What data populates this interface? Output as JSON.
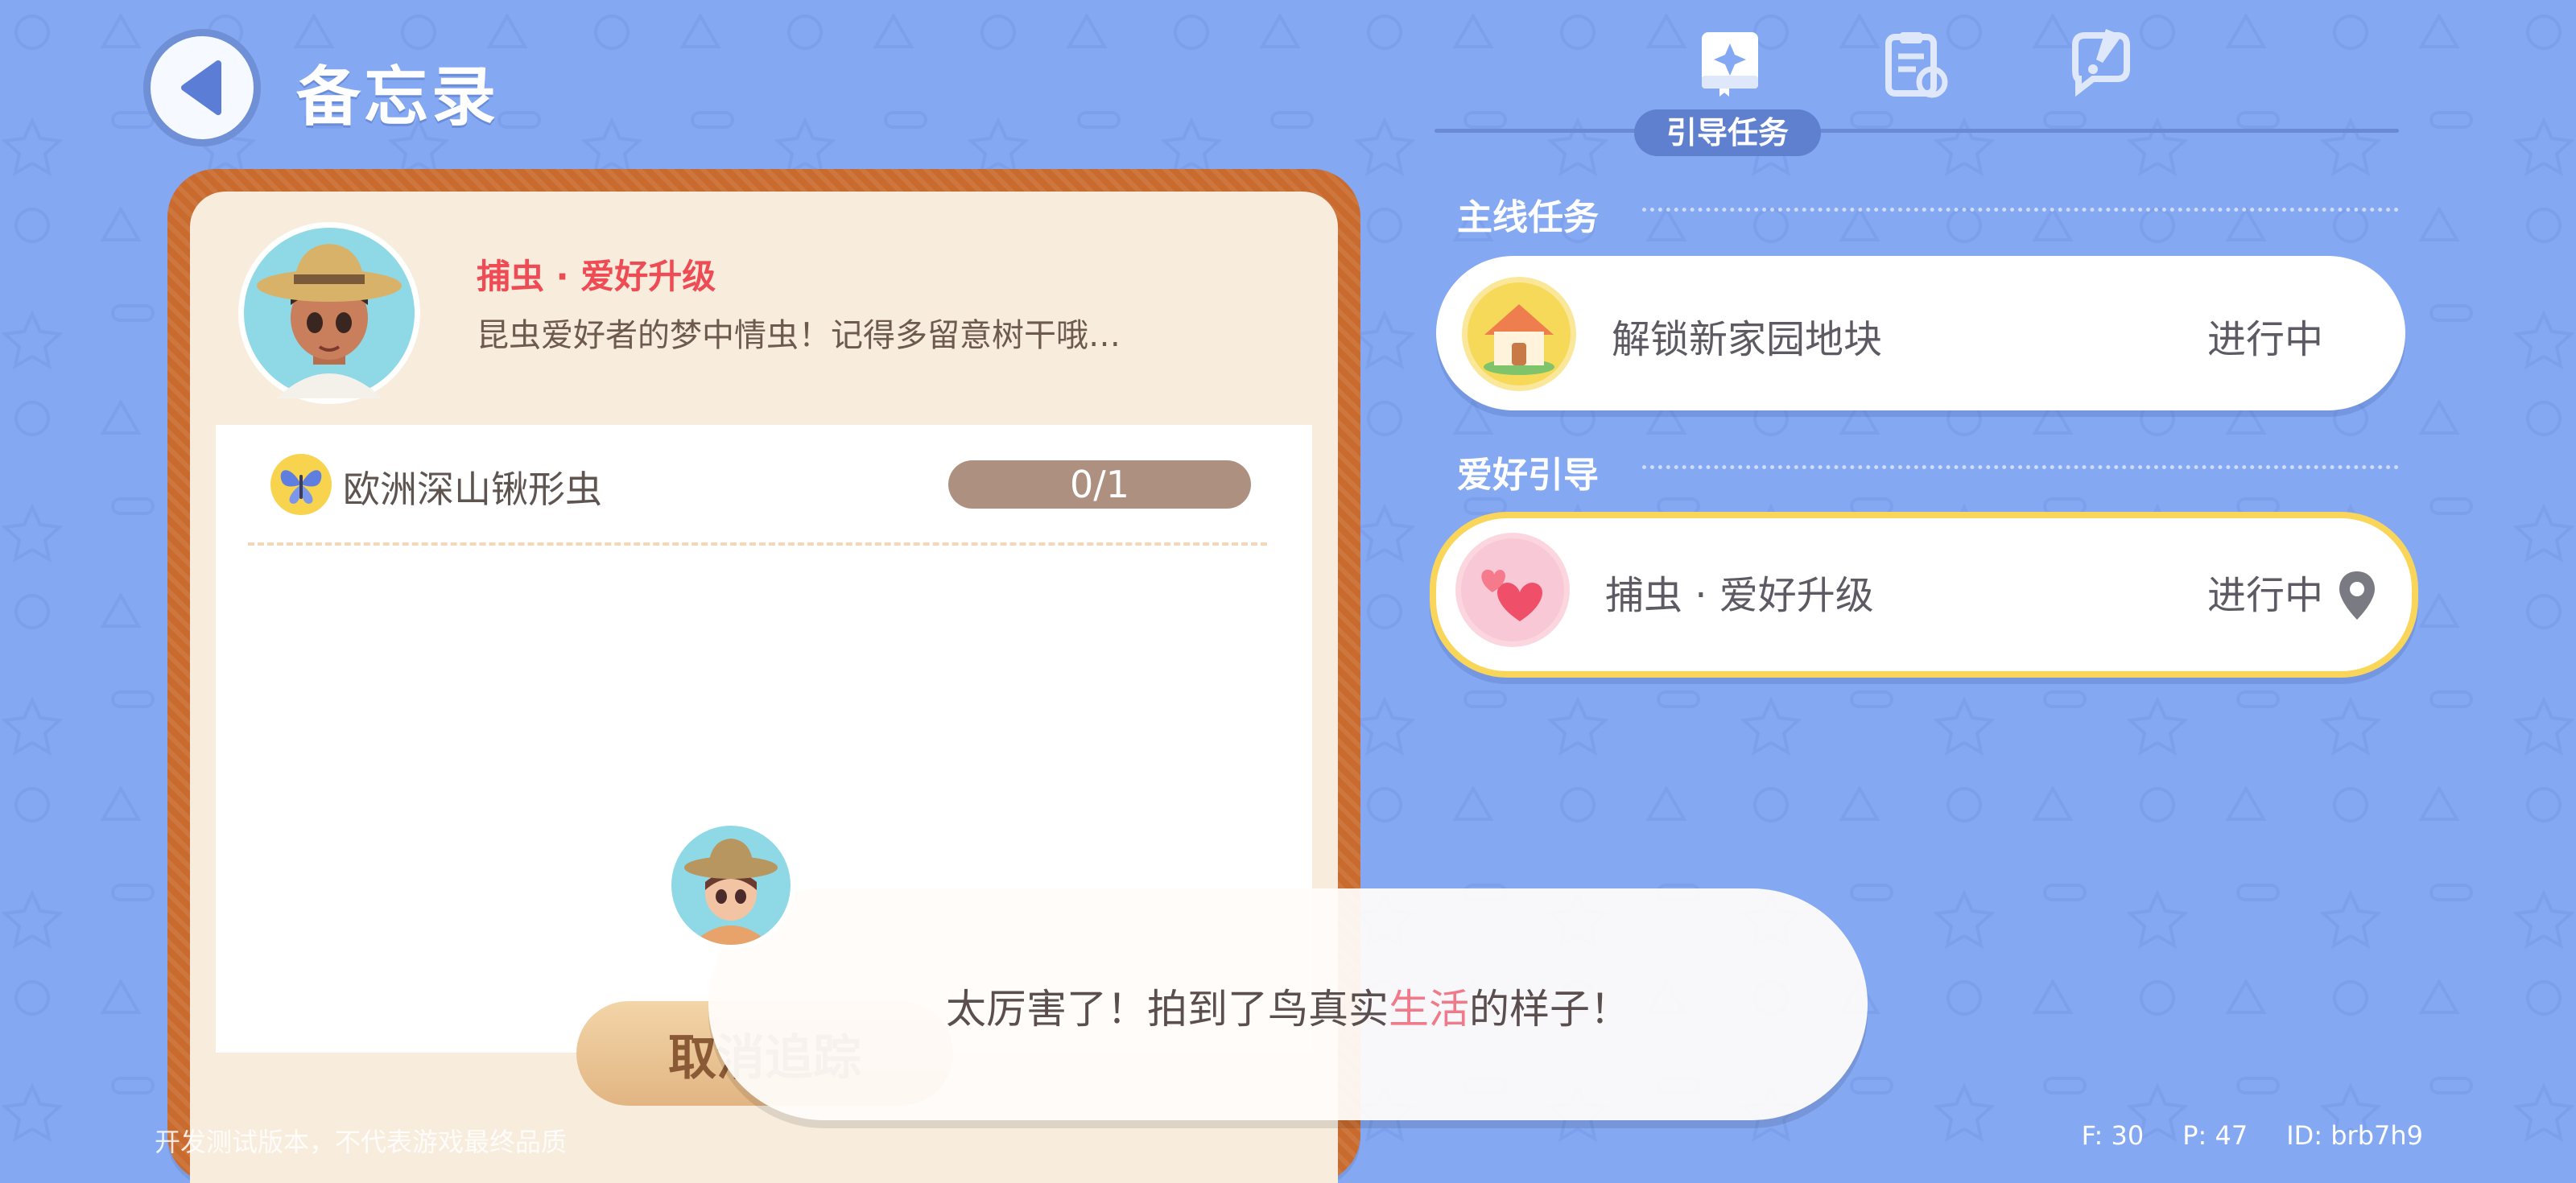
{
  "header": {
    "title": "备忘录",
    "back_icon": "chevron-left-icon"
  },
  "tabs": [
    {
      "icon": "guide-book-icon",
      "label": "引导任务",
      "active": true
    },
    {
      "icon": "clipboard-refresh-icon",
      "active": false
    },
    {
      "icon": "chat-exclamation-icon",
      "active": false
    }
  ],
  "memo": {
    "task_title": "捕虫 · 爱好升级",
    "task_desc": "昆虫爱好者的梦中情虫！记得多留意树干哦…",
    "target_name": "欧洲深山锹形虫",
    "target_icon": "butterfly-icon",
    "progress": "0/1",
    "untrack_button": "取消追踪"
  },
  "sections": {
    "main": {
      "title": "主线任务",
      "quest": {
        "name": "解锁新家园地块",
        "status": "进行中",
        "icon": "house-icon"
      }
    },
    "hobby": {
      "title": "爱好引导",
      "quest": {
        "name": "捕虫 · 爱好升级",
        "status": "进行中",
        "icon": "hearts-icon",
        "marker_icon": "location-pin-icon"
      }
    }
  },
  "dialogue": {
    "before": "太厉害了！拍到了鸟真实",
    "highlight": "生活",
    "after": "的样子！"
  },
  "footer": {
    "notice": "开发测试版本，不代表游戏最终品质",
    "f": "F: 30",
    "p": "P: 47",
    "id": "ID: brb7h9"
  },
  "colors": {
    "background": "#84a8f2",
    "accent_red": "#ef4b55",
    "frame_orange": "#c96a2e",
    "selected_border": "#f9d65a"
  }
}
